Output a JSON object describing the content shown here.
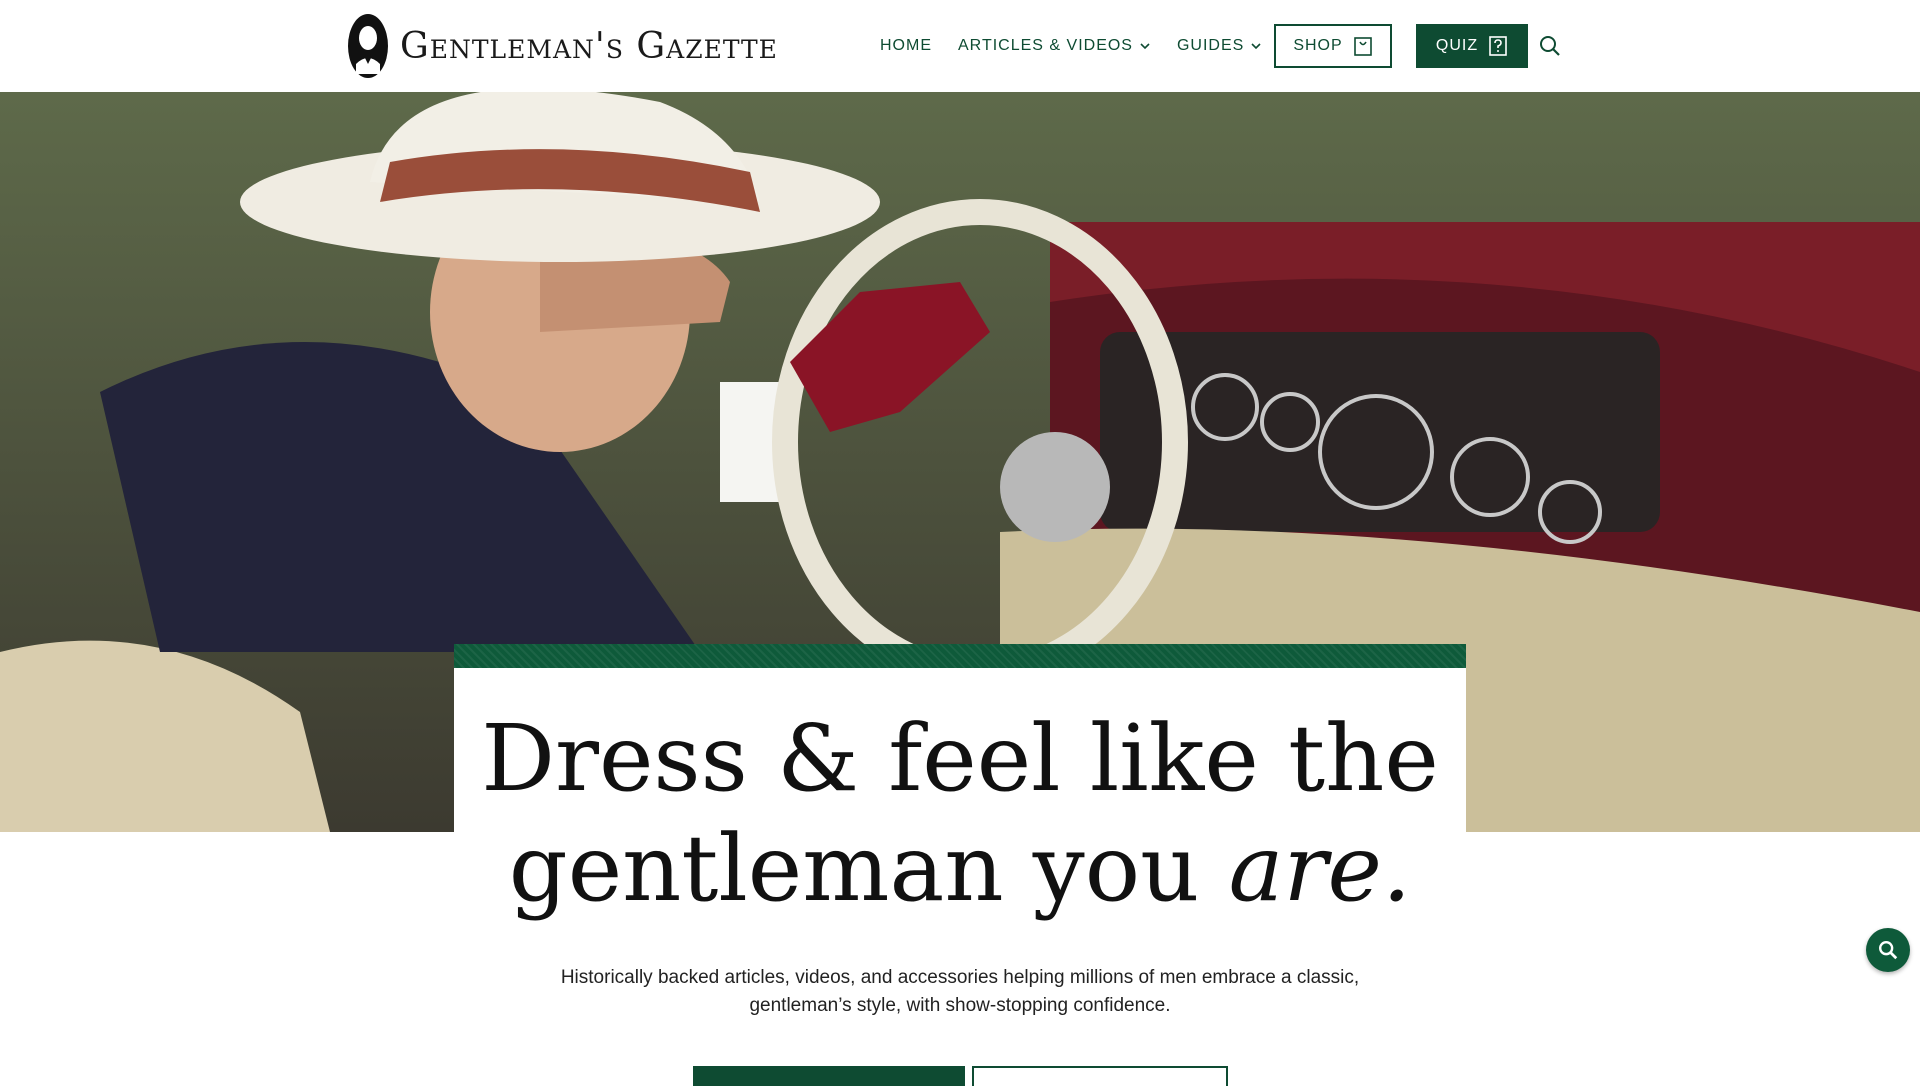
{
  "brand": {
    "name": "Gentleman's Gazette"
  },
  "nav": {
    "home": "HOME",
    "articles": "ARTICLES & VIDEOS",
    "guides": "GUIDES",
    "shop": "SHOP",
    "quiz": "QUIZ"
  },
  "hero": {
    "headline_line1": "Dress & feel like the",
    "headline_line2": "gentleman you ",
    "headline_emphasis": "are.",
    "subtitle": "Historically backed articles, videos, and accessories helping millions of men embrace a classic, gentleman’s style, with show-stopping confidence."
  },
  "icons": {
    "search": "search-icon",
    "shop": "shopping-bag-icon",
    "quiz": "quiz-icon",
    "chevron": "chevron-down-icon"
  },
  "colors": {
    "brand_green": "#0e4b32",
    "accent_green": "#0e5a3a"
  }
}
